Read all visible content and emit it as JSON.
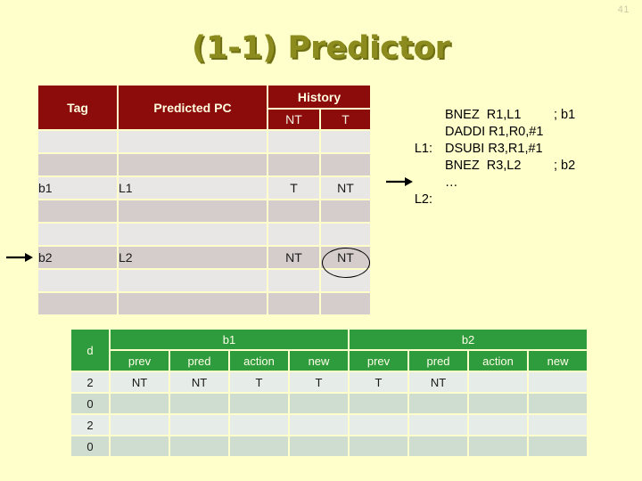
{
  "page": {
    "number": "41"
  },
  "title": {
    "text": "(1-1) Predictor"
  },
  "theme": {
    "background": "#FFFFCC",
    "title_color": "#8C8C1E",
    "title_shadow": "#6E6E12",
    "predictor_header_bg": "#8C0B0B",
    "predictor_header_fg": "#FFFFE0",
    "trace_header_bg": "#2E9B3C",
    "trace_header_fg": "#FFFFE8",
    "highlight_color": "#CC0000",
    "row_light": "#E9E6E6",
    "row_dark": "#D5CCCC",
    "trace_row_light": "#E6ECE8",
    "trace_row_dark": "#CFDDD0"
  },
  "predictor_table": {
    "headers": {
      "tag": "Tag",
      "predicted_pc": "Predicted PC",
      "history": "History",
      "history_nt": "NT",
      "history_t": "T"
    },
    "rows": [
      {
        "shade": "light",
        "tag": "",
        "pc": "",
        "nt": "",
        "t": ""
      },
      {
        "shade": "dark",
        "tag": "",
        "pc": "",
        "nt": "",
        "t": ""
      },
      {
        "shade": "light",
        "tag": "b1",
        "pc": "L1",
        "nt": "T",
        "t": "NT"
      },
      {
        "shade": "dark",
        "tag": "",
        "pc": "",
        "nt": "",
        "t": ""
      },
      {
        "shade": "light",
        "tag": "",
        "pc": "",
        "nt": "",
        "t": ""
      },
      {
        "shade": "dark",
        "tag": "b2",
        "pc": "L2",
        "nt": "NT",
        "t": "NT"
      },
      {
        "shade": "light",
        "tag": "",
        "pc": "",
        "nt": "",
        "t": ""
      },
      {
        "shade": "dark",
        "tag": "",
        "pc": "",
        "nt": "",
        "t": ""
      }
    ],
    "circled_cell": "row 5, History T = NT"
  },
  "code_listing": {
    "lines": [
      {
        "label": "",
        "instruction": "BNEZ  R1,L1",
        "comment": "; b1"
      },
      {
        "label": "",
        "instruction": "DADDI R1,R0,#1",
        "comment": ""
      },
      {
        "label": "L1:",
        "instruction": "DSUBI R3,R1,#1",
        "comment": ""
      },
      {
        "label": "",
        "instruction": "BNEZ  R3,L2",
        "comment": "; b2"
      },
      {
        "label": "",
        "instruction": "…",
        "comment": ""
      },
      {
        "label": "L2:",
        "instruction": "",
        "comment": ""
      }
    ],
    "pointer_line_index": 3
  },
  "trace_table": {
    "group_headers": {
      "d": "d",
      "b1": "b1",
      "b2": "b2"
    },
    "sub_headers": [
      "prev",
      "pred",
      "action",
      "new"
    ],
    "rows": [
      {
        "shade": "light",
        "d": "2",
        "b1": {
          "prev": "NT",
          "pred": "NT",
          "action": "T",
          "new": "T",
          "new_highlight": true
        },
        "b2": {
          "prev": "T",
          "pred": "NT",
          "action": "",
          "new": "",
          "new_highlight": false
        }
      },
      {
        "shade": "dark",
        "d": "0",
        "b1": {
          "prev": "",
          "pred": "",
          "action": "",
          "new": "",
          "new_highlight": false
        },
        "b2": {
          "prev": "",
          "pred": "",
          "action": "",
          "new": "",
          "new_highlight": false
        }
      },
      {
        "shade": "light",
        "d": "2",
        "b1": {
          "prev": "",
          "pred": "",
          "action": "",
          "new": "",
          "new_highlight": false
        },
        "b2": {
          "prev": "",
          "pred": "",
          "action": "",
          "new": "",
          "new_highlight": false
        }
      },
      {
        "shade": "dark",
        "d": "0",
        "b1": {
          "prev": "",
          "pred": "",
          "action": "",
          "new": "",
          "new_highlight": false
        },
        "b2": {
          "prev": "",
          "pred": "",
          "action": "",
          "new": "",
          "new_highlight": false
        }
      }
    ]
  }
}
